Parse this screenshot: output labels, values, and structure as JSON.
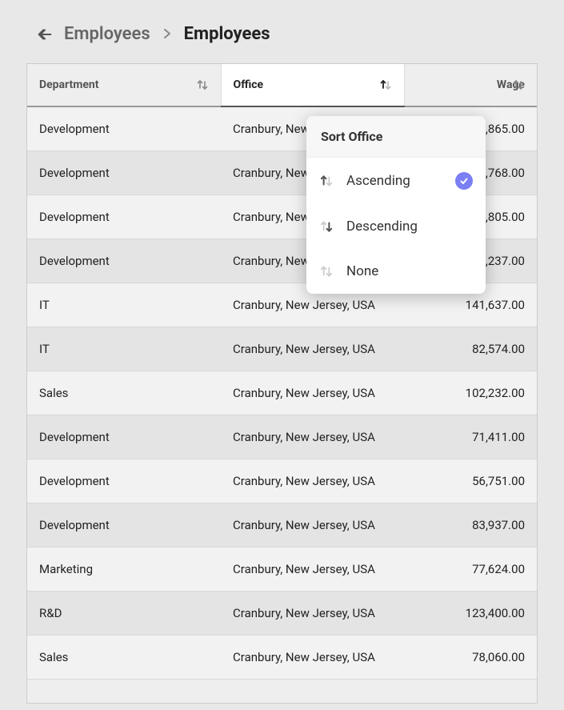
{
  "breadcrumb": {
    "parent": "Employees",
    "current": "Employees"
  },
  "table": {
    "columns": [
      {
        "key": "department",
        "label": "Department",
        "active": false
      },
      {
        "key": "office",
        "label": "Office",
        "active": true
      },
      {
        "key": "wage",
        "label": "Wage",
        "active": false
      }
    ],
    "rows": [
      {
        "department": "Development",
        "office": "Cranbury, New Jersey, USA",
        "wage": "176,865.00"
      },
      {
        "department": "Development",
        "office": "Cranbury, New Jersey, USA",
        "wage": "173,768.00"
      },
      {
        "department": "Development",
        "office": "Cranbury, New Jersey, USA",
        "wage": "146,805.00"
      },
      {
        "department": "Development",
        "office": "Cranbury, New Jersey, USA",
        "wage": "4,237.00"
      },
      {
        "department": "IT",
        "office": "Cranbury, New Jersey, USA",
        "wage": "141,637.00"
      },
      {
        "department": "IT",
        "office": "Cranbury, New Jersey, USA",
        "wage": "82,574.00"
      },
      {
        "department": "Sales",
        "office": "Cranbury, New Jersey, USA",
        "wage": "102,232.00"
      },
      {
        "department": "Development",
        "office": "Cranbury, New Jersey, USA",
        "wage": "71,411.00"
      },
      {
        "department": "Development",
        "office": "Cranbury, New Jersey, USA",
        "wage": "56,751.00"
      },
      {
        "department": "Development",
        "office": "Cranbury, New Jersey, USA",
        "wage": "83,937.00"
      },
      {
        "department": "Marketing",
        "office": "Cranbury, New Jersey, USA",
        "wage": "77,624.00"
      },
      {
        "department": "R&D",
        "office": "Cranbury, New Jersey, USA",
        "wage": "123,400.00"
      },
      {
        "department": "Sales",
        "office": "Cranbury, New Jersey, USA",
        "wage": "78,060.00"
      }
    ]
  },
  "sortPopover": {
    "title": "Sort Office",
    "options": [
      {
        "label": "Ascending",
        "selected": true,
        "icon": "asc"
      },
      {
        "label": "Descending",
        "selected": false,
        "icon": "desc"
      },
      {
        "label": "None",
        "selected": false,
        "icon": "none"
      }
    ]
  }
}
